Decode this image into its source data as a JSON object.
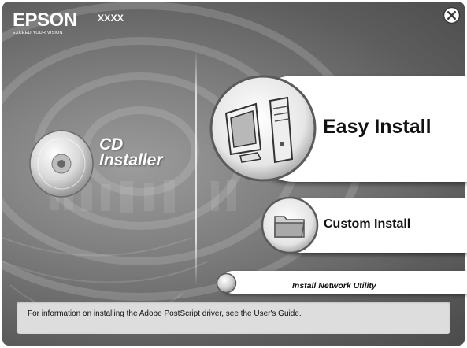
{
  "header": {
    "brand_name": "EPSON",
    "brand_tagline": "EXCEED YOUR VISION",
    "model": "XXXX"
  },
  "close_button": {
    "icon": "close-circle-icon"
  },
  "cd_installer": {
    "title_line1": "CD",
    "title_line2": "Installer",
    "icon": "cd-disc-icon"
  },
  "options": {
    "easy_install": {
      "label": "Easy Install",
      "icon": "desktop-computer-icon"
    },
    "custom_install": {
      "label": "Custom Install",
      "icon": "folder-icon"
    },
    "network_utility": {
      "label": "Install Network Utility",
      "icon": "circle-bullet-icon"
    }
  },
  "info_bar": {
    "text": "For information on installing the Adobe PostScript driver, see the User's Guide."
  },
  "colors": {
    "background_dark": "#4b4b4b",
    "background_light": "#9c9c9c",
    "button_fill": "#ffffff",
    "info_bar": "#dddddd"
  }
}
